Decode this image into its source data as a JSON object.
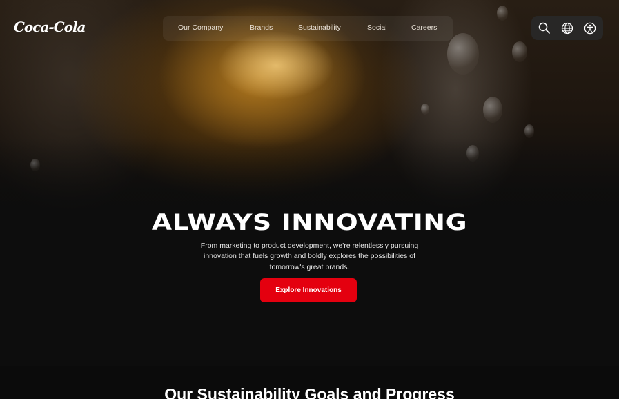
{
  "header": {
    "logo_text": "Coca-Cola",
    "nav": [
      {
        "label": "Our Company"
      },
      {
        "label": "Brands"
      },
      {
        "label": "Sustainability"
      },
      {
        "label": "Social"
      },
      {
        "label": "Careers"
      }
    ],
    "utility_icons": [
      "search-icon",
      "globe-icon",
      "accessibility-icon"
    ]
  },
  "hero": {
    "title": "ALWAYS INNOVATING",
    "description": "From marketing to product development, we're relentlessly pursuing innovation that fuels growth and boldly explores the possibilities of tomorrow's great brands.",
    "cta_label": "Explore Innovations"
  },
  "sustainability": {
    "title": "Our Sustainability Goals and Progress"
  },
  "colors": {
    "brand_red": "#e4000f",
    "background": "#0d0d0d",
    "text": "#ffffff"
  }
}
